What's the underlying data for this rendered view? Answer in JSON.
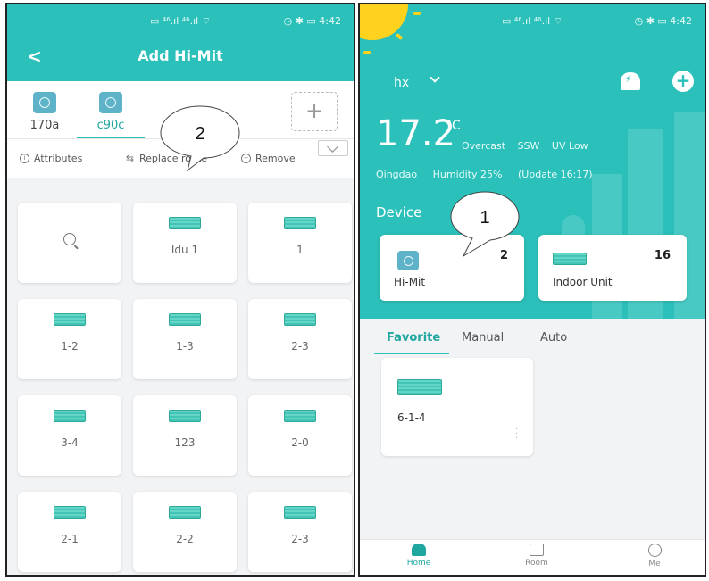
{
  "left_screen": {
    "status": {
      "network": "▭ ⁴⁶.ıl ⁴⁶.ıl ⌔",
      "right": "◷ ✱ ▭ 4:42"
    },
    "header": {
      "back": "<",
      "title": "Add Hi-Mit"
    },
    "gateway_tabs": [
      {
        "label": "170a",
        "icon": "gateway-icon"
      },
      {
        "label": "c90c",
        "icon": "gateway-icon",
        "active": true
      }
    ],
    "add_tab_label": "+",
    "actions": [
      {
        "label": "Attributes",
        "icon": "info-icon"
      },
      {
        "label": "Replace route",
        "icon": "swap-icon"
      },
      {
        "label": "Remove",
        "icon": "minus-circle-icon"
      }
    ],
    "cards": [
      {
        "label": "",
        "icon": "search-icon"
      },
      {
        "label": "Idu 1",
        "icon": "indoor-unit-icon"
      },
      {
        "label": "1",
        "icon": "indoor-unit-icon"
      },
      {
        "label": "1-2",
        "icon": "indoor-unit-icon"
      },
      {
        "label": "1-3",
        "icon": "indoor-unit-icon"
      },
      {
        "label": "2-3",
        "icon": "indoor-unit-icon"
      },
      {
        "label": "3-4",
        "icon": "indoor-unit-icon"
      },
      {
        "label": "123",
        "icon": "indoor-unit-icon"
      },
      {
        "label": "2-0",
        "icon": "indoor-unit-icon"
      },
      {
        "label": "2-1",
        "icon": "indoor-unit-icon"
      },
      {
        "label": "2-2",
        "icon": "indoor-unit-icon"
      },
      {
        "label": "2-3",
        "icon": "indoor-unit-icon"
      }
    ],
    "callout": "2"
  },
  "right_screen": {
    "status": {
      "network": "▭ ⁴⁶.ıl ⁴⁶.ıl ⌔",
      "right": "◷ ✱ ▭ 4:42"
    },
    "home_name": "hx",
    "temperature": "17.2",
    "temperature_unit": "°C",
    "weather": {
      "condition": "Overcast",
      "wind": "SSW",
      "uv": "UV Low"
    },
    "location": {
      "city": "Qingdao",
      "humidity": "Humidity 25%",
      "update": "(Update 16:17)"
    },
    "device_section_title": "Device",
    "device_cards": [
      {
        "label": "Hi-Mit",
        "count": "2",
        "icon": "gateway-icon"
      },
      {
        "label": "Indoor Unit",
        "count": "16",
        "icon": "indoor-unit-icon"
      }
    ],
    "tabs": [
      {
        "label": "Favorite",
        "active": true
      },
      {
        "label": "Manual"
      },
      {
        "label": "Auto"
      }
    ],
    "favorite_card": {
      "label": "6-1-4",
      "more": "⋮"
    },
    "bottom_nav": [
      {
        "label": "Home",
        "icon": "home-icon",
        "active": true
      },
      {
        "label": "Room",
        "icon": "room-icon"
      },
      {
        "label": "Me",
        "icon": "profile-icon"
      }
    ],
    "callout": "1"
  },
  "colors": {
    "accent": "#2cc0ba",
    "accent_dark": "#1fa69f",
    "unit_green": "#43c4b5",
    "gateway_blue": "#5fb3c9",
    "sun": "#ffd21e"
  }
}
